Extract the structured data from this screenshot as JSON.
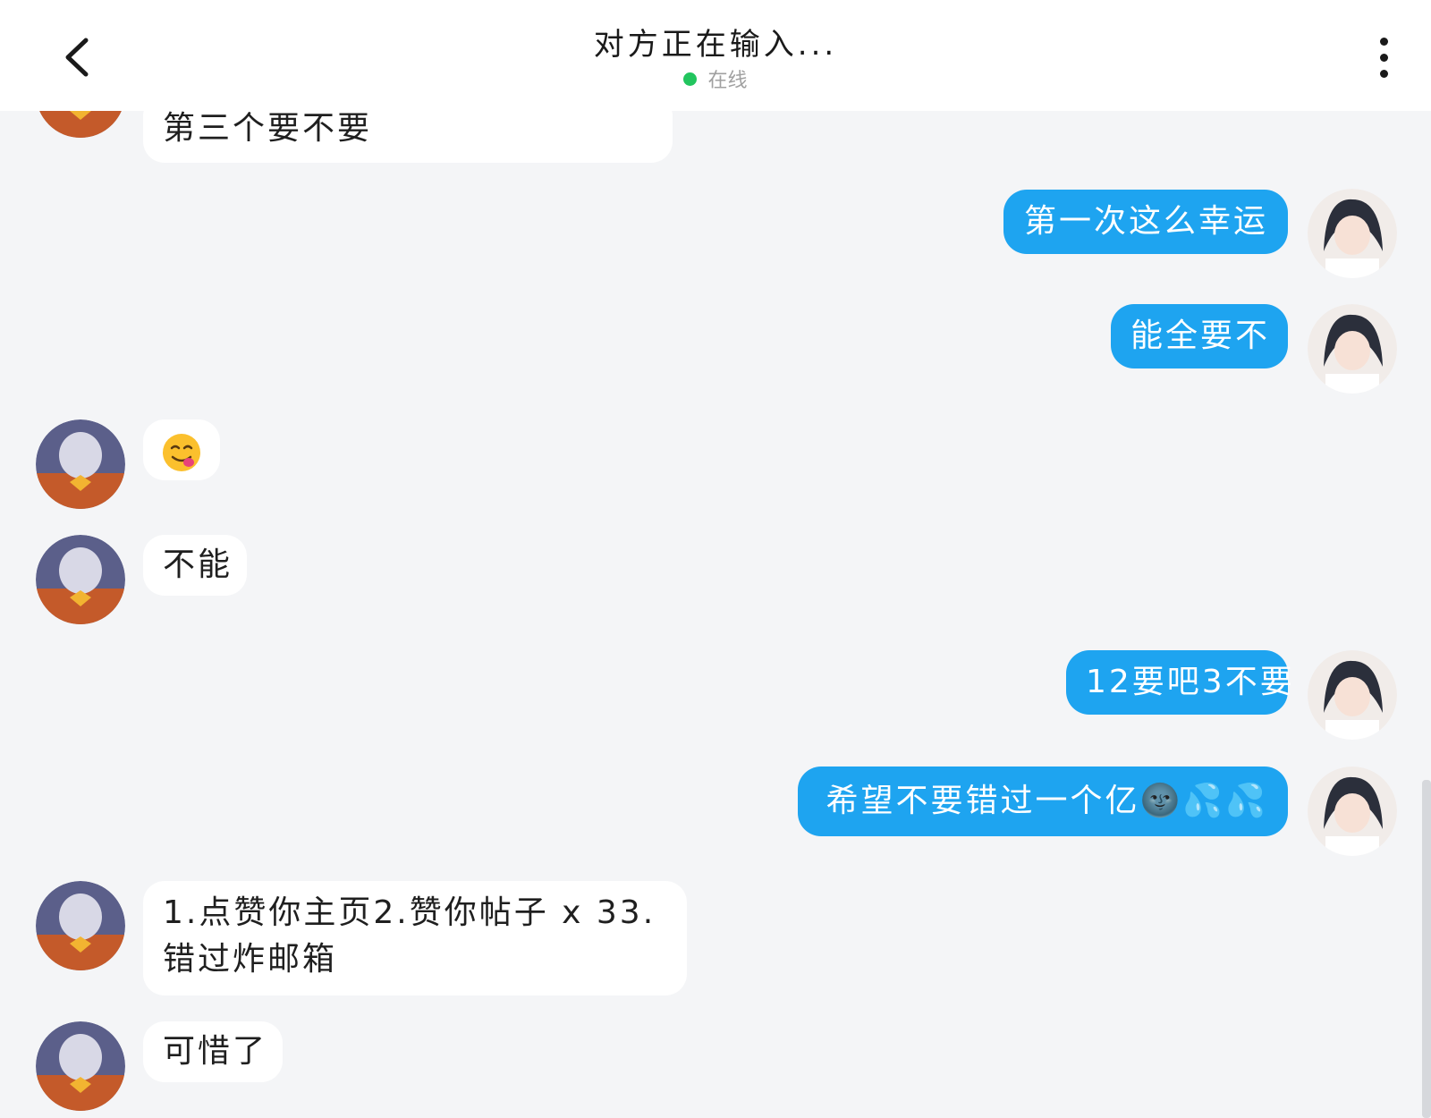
{
  "header": {
    "title": "对方正在输入...",
    "status": "在线",
    "back_icon": "chevron-left-icon",
    "more_icon": "more-vertical-icon",
    "status_color": "#22c55e"
  },
  "colors": {
    "outgoing_bubble": "#1ea4f0",
    "incoming_bubble": "#ffffff",
    "background": "#f4f5f7"
  },
  "messages": [
    {
      "side": "in",
      "text": "第三个要不要"
    },
    {
      "side": "out",
      "text": "第一次这么幸运"
    },
    {
      "side": "out",
      "text": "能全要不"
    },
    {
      "side": "in",
      "text": "",
      "emoji": "yum-face-emoji"
    },
    {
      "side": "in",
      "text": "不能"
    },
    {
      "side": "out",
      "text": "12要吧3不要"
    },
    {
      "side": "out",
      "text": "希望不要错过一个亿🌚💦💦"
    },
    {
      "side": "in",
      "text": "1.点赞你主页2.赞你帖子 x 33.错过炸邮箱"
    },
    {
      "side": "in",
      "text": "可惜了"
    }
  ]
}
